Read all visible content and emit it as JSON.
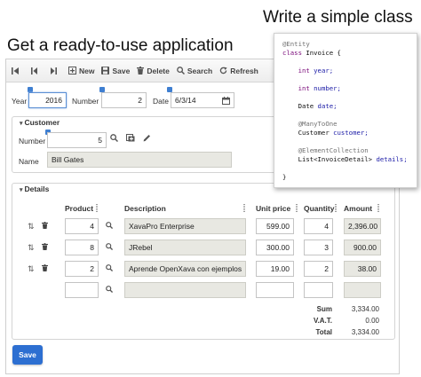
{
  "headlines": {
    "right": "Write a simple class",
    "left": "Get a ready-to-use application"
  },
  "toolbar": {
    "new_label": "New",
    "save_label": "Save",
    "delete_label": "Delete",
    "search_label": "Search",
    "refresh_label": "Refresh"
  },
  "form": {
    "year_label": "Year",
    "year_value": "2016",
    "number_label": "Number",
    "number_value": "2",
    "date_label": "Date",
    "date_value": "6/3/14"
  },
  "customer": {
    "title": "Customer",
    "number_label": "Number",
    "number_value": "5",
    "name_label": "Name",
    "name_value": "Bill Gates"
  },
  "details": {
    "title": "Details",
    "columns": {
      "product": "Product",
      "description": "Description",
      "unit_price": "Unit price",
      "quantity": "Quantity",
      "amount": "Amount"
    },
    "rows": [
      {
        "product": "4",
        "description": "XavaPro Enterprise",
        "unit_price": "599.00",
        "quantity": "4",
        "amount": "2,396.00"
      },
      {
        "product": "8",
        "description": "JRebel",
        "unit_price": "300.00",
        "quantity": "3",
        "amount": "900.00"
      },
      {
        "product": "2",
        "description": "Aprende OpenXava con ejemplos",
        "unit_price": "19.00",
        "quantity": "2",
        "amount": "38.00"
      },
      {
        "product": "",
        "description": "",
        "unit_price": "",
        "quantity": "",
        "amount": ""
      }
    ],
    "totals": {
      "sum_label": "Sum",
      "sum_value": "3,334.00",
      "vat_label": "V.A.T.",
      "vat_value": "0.00",
      "total_label": "Total",
      "total_value": "3,334.00"
    }
  },
  "save_button": "Save",
  "code": {
    "l1": "@Entity",
    "l2a": "class",
    "l2b": " Invoice {",
    "l3a": "    int",
    "l3b": " year;",
    "l4a": "    int",
    "l4b": " number;",
    "l5a": "    Date",
    "l5b": " date;",
    "l6": "    @ManyToOne",
    "l7a": "    Customer",
    "l7b": " customer;",
    "l8": "    @ElementCollection",
    "l9a": "    List<InvoiceDetail>",
    "l9b": " details;",
    "l10": "}"
  },
  "colors": {
    "accent": "#2d6fd1",
    "readonly_field": "#e8e8e2"
  }
}
